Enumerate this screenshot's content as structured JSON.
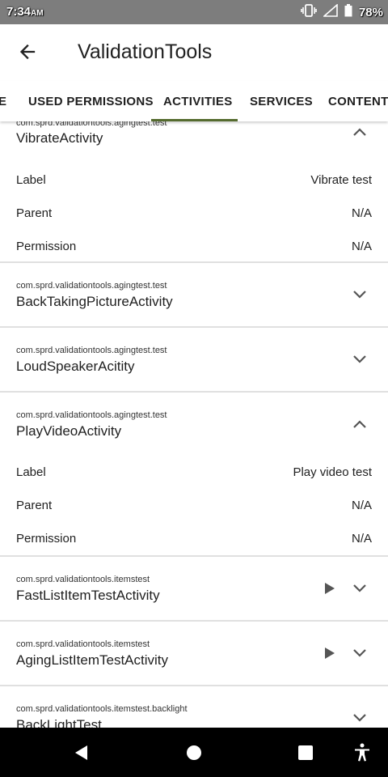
{
  "status_bar": {
    "time": "7:34",
    "ampm": "AM",
    "battery": "78%"
  },
  "app_bar": {
    "title": "ValidationTools"
  },
  "tabs": [
    {
      "label": "E"
    },
    {
      "label": "USED PERMISSIONS"
    },
    {
      "label": "ACTIVITIES",
      "selected": true
    },
    {
      "label": "SERVICES"
    },
    {
      "label": "CONTENT P"
    }
  ],
  "activities": [
    {
      "package": "com.sprd.validationtools.agingtest.test",
      "name": "VibrateActivity",
      "expanded": true,
      "details": [
        {
          "label": "Label",
          "value": "Vibrate test"
        },
        {
          "label": "Parent",
          "value": "N/A"
        },
        {
          "label": "Permission",
          "value": "N/A"
        }
      ]
    },
    {
      "package": "com.sprd.validationtools.agingtest.test",
      "name": "BackTakingPictureActivity",
      "expanded": false
    },
    {
      "package": "com.sprd.validationtools.agingtest.test",
      "name": "LoudSpeakerAcitity",
      "expanded": false
    },
    {
      "package": "com.sprd.validationtools.agingtest.test",
      "name": "PlayVideoActivity",
      "expanded": true,
      "details": [
        {
          "label": "Label",
          "value": "Play video test"
        },
        {
          "label": "Parent",
          "value": "N/A"
        },
        {
          "label": "Permission",
          "value": "N/A"
        }
      ]
    },
    {
      "package": "com.sprd.validationtools.itemstest",
      "name": "FastListItemTestActivity",
      "expanded": false,
      "launchable": true
    },
    {
      "package": "com.sprd.validationtools.itemstest",
      "name": "AgingListItemTestActivity",
      "expanded": false,
      "launchable": true
    },
    {
      "package": "com.sprd.validationtools.itemstest.backlight",
      "name": "BackLightTest",
      "expanded": false
    }
  ],
  "colors": {
    "tab_indicator": "#556b2f",
    "status_bar": "#7d7d7d"
  }
}
